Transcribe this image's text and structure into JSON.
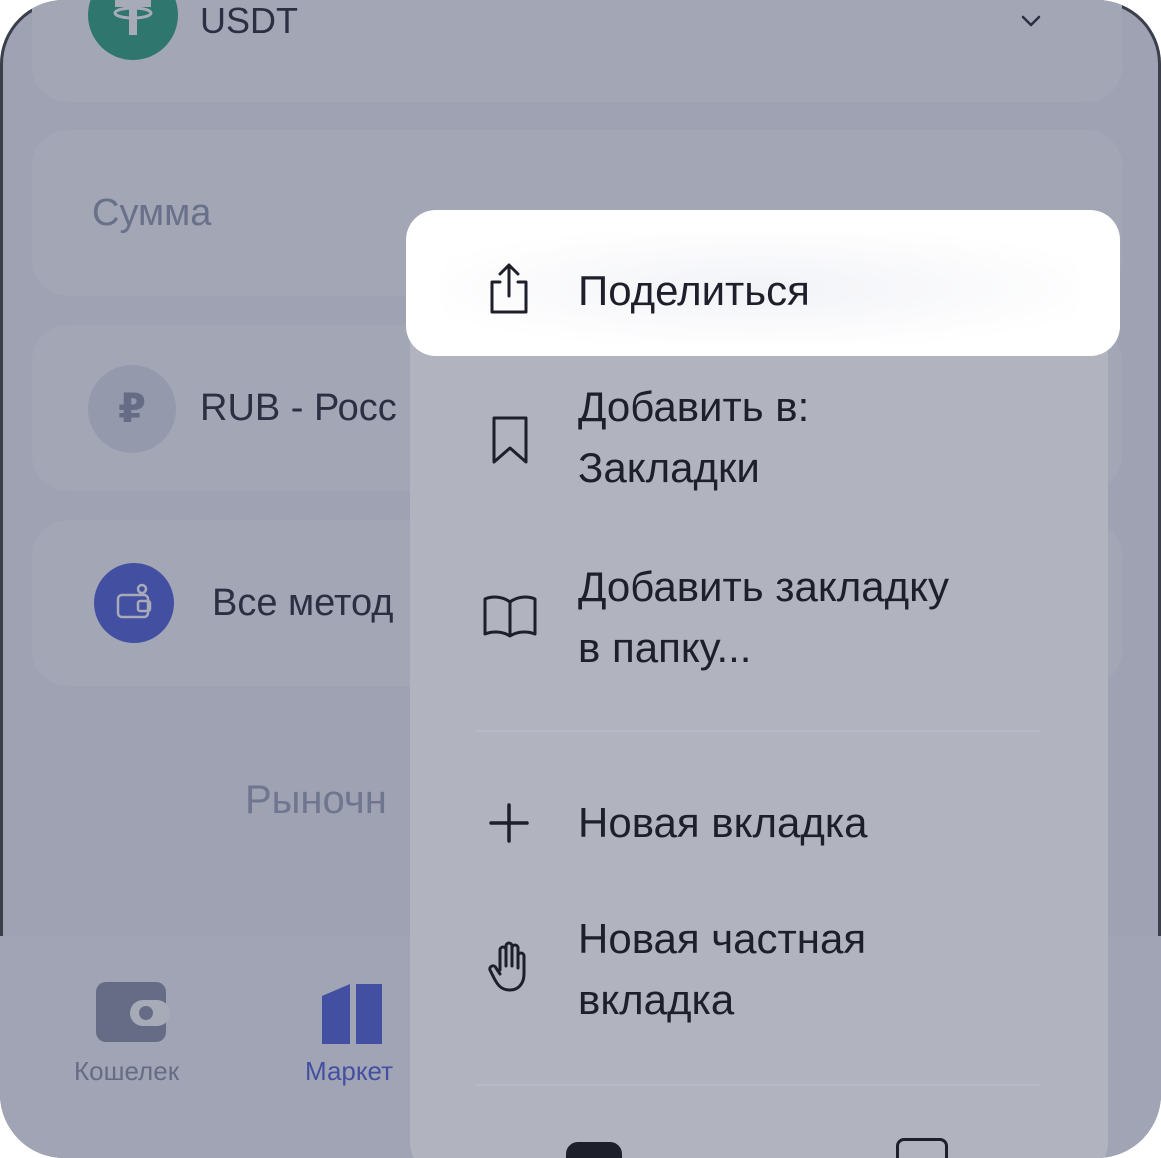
{
  "screen": {
    "currency_label": "USDT",
    "amount_placeholder": "Сумма",
    "fiat_label": "RUB - Росс",
    "method_label": "Все метод",
    "market_label": "Рыночн",
    "ruble_symbol": "₽"
  },
  "tabbar": {
    "items": [
      {
        "label": "Кошелек",
        "icon": "wallet-icon",
        "color": "#8a8fa6"
      },
      {
        "label": "Маркет",
        "icon": "market-icon",
        "color": "#4a5bd8"
      }
    ]
  },
  "context_menu": {
    "items": [
      {
        "label": "Поделиться",
        "icon": "share-icon",
        "highlighted": true
      },
      {
        "label_line1": "Добавить в:",
        "label_line2": "Закладки",
        "icon": "bookmark-icon"
      },
      {
        "label_line1": "Добавить закладку",
        "label_line2": "в папку...",
        "icon": "open-book-icon"
      },
      {
        "label": "Новая вкладка",
        "icon": "plus-icon"
      },
      {
        "label_line1": "Новая частная",
        "label_line2": "вкладка",
        "icon": "hand-icon"
      }
    ]
  },
  "colors": {
    "accent": "#4a5bd8",
    "usdt_green": "#26a17b",
    "overlay": "#3c425f"
  }
}
